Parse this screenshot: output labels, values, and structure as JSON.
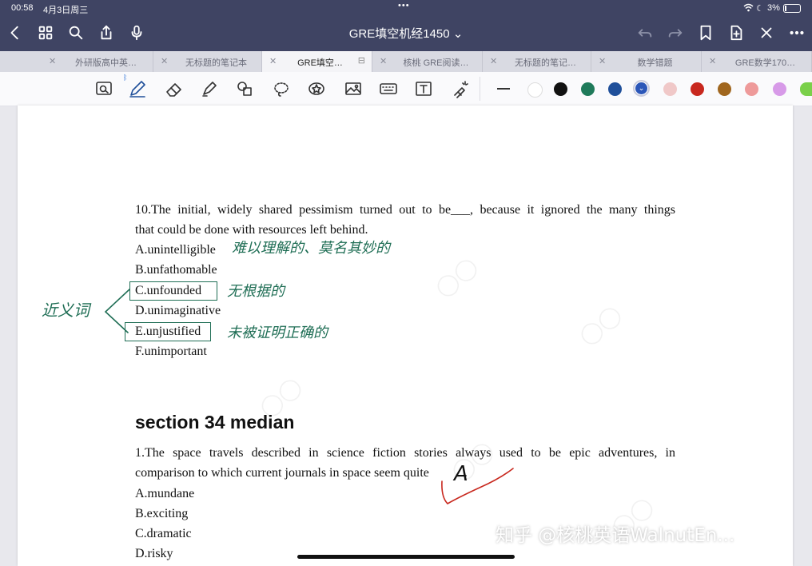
{
  "status_bar": {
    "time": "00:58",
    "date": "4月3日周三",
    "battery": "3%"
  },
  "nav": {
    "title": "GRE填空机经1450 ⌄"
  },
  "tabs": [
    {
      "label": "外研版高中英…"
    },
    {
      "label": "无标题的笔记本"
    },
    {
      "label": "GRE填空…"
    },
    {
      "label": "核桃 GRE阅读…"
    },
    {
      "label": "无标题的笔记…"
    },
    {
      "label": "数学错题"
    },
    {
      "label": "GRE数学170…"
    }
  ],
  "toolbar": {
    "colors": [
      "#ffffff",
      "#111111",
      "#1f7a5a",
      "#1f4f9a",
      "#2b56b8",
      "#f0c8c8",
      "#c8281e",
      "#a0661e",
      "#ee9a9a",
      "#d79ae8",
      "#7ad04a"
    ]
  },
  "content": {
    "q10_text": "10.The initial, widely shared pessimism turned out to be___, because it ignored the many things",
    "q10_text2": "that could be done with resources left behind.",
    "q10_options": [
      "A.unintelligible",
      "B.unfathomable",
      "C.unfounded",
      "D.unimaginative",
      "E.unjustified",
      "F.unimportant"
    ],
    "section_heading": "section 34 median",
    "q1_text": "1.The space travels described in science fiction stories always used to be epic adventures, in",
    "q1_text2": "comparison to which current journals in space seem quite",
    "q1_blank_end": ".",
    "q1_options": [
      "A.mundane",
      "B.exciting",
      "C.dramatic",
      "D.risky"
    ]
  },
  "annotations": {
    "note_a": "难以理解的、莫名其妙的",
    "note_c": "无根据的",
    "note_e": "未被证明正确的",
    "synonym": "近义词",
    "answer_mark": "A"
  },
  "watermark": {
    "zhihu": "知乎 @核桃英语WalnutEn..."
  }
}
